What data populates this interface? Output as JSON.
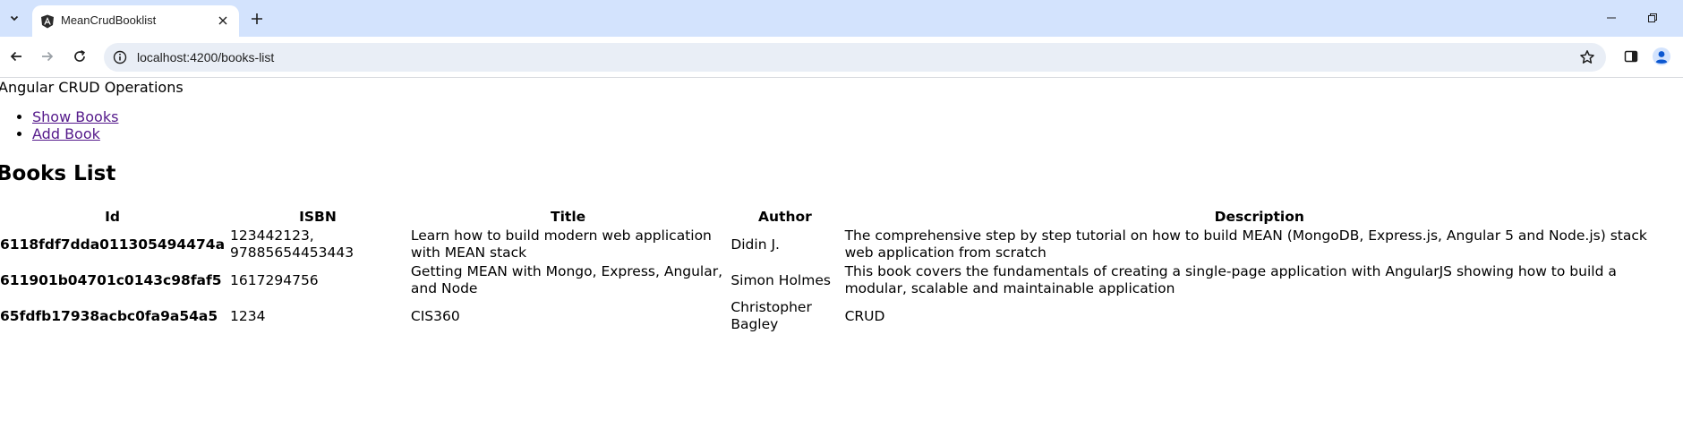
{
  "browser": {
    "tab": {
      "title": "MeanCrudBooklist",
      "favicon": "angular-logo-icon"
    },
    "address_bar": {
      "url": "localhost:4200/books-list"
    },
    "colors": {
      "tabstrip_bg": "#d3e3fd",
      "omnibox_bg": "#e9eef6",
      "profile_accent": "#0b57d0"
    }
  },
  "app": {
    "title": "Angular CRUD Operations",
    "nav": [
      {
        "label": "Show Books"
      },
      {
        "label": "Add Book"
      }
    ],
    "link_color": "#551a8b"
  },
  "books_list": {
    "heading": "Books List",
    "columns": [
      "Id",
      "ISBN",
      "Title",
      "Author",
      "Description"
    ],
    "rows": [
      {
        "id": "6118fdf7dda011305494474a",
        "isbn": "123442123, 97885654453443",
        "title": "Learn how to build modern web application with MEAN stack",
        "author": "Didin J.",
        "description": "The comprehensive step by step tutorial on how to build MEAN (MongoDB, Express.js, Angular 5 and Node.js) stack web application from scratch"
      },
      {
        "id": "611901b04701c0143c98faf5",
        "isbn": "1617294756",
        "title": "Getting MEAN with Mongo, Express, Angular, and Node",
        "author": "Simon Holmes",
        "description": "This book covers the fundamentals of creating a single-page application with AngularJS showing how to build a modular, scalable and maintainable application"
      },
      {
        "id": "65fdfb17938acbc0fa9a54a5",
        "isbn": "1234",
        "title": "CIS360",
        "author": "Christopher Bagley",
        "description": "CRUD"
      }
    ]
  }
}
